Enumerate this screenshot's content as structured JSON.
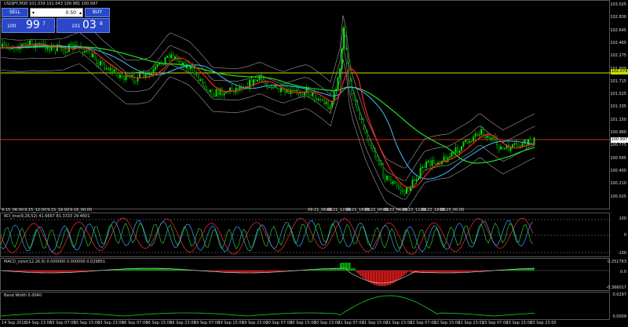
{
  "chart_title": "USDJPY,M30  101.039 101.043 100.981 100.997",
  "trade_panel": {
    "sell_label": "SELL",
    "buy_label": "BUY",
    "volume": "0.50",
    "bid_small": "100",
    "bid_big": "99",
    "bid_sup": "7",
    "ask_small": "101",
    "ask_big": "03",
    "ask_sup": "8"
  },
  "price_axis": [
    "103.025",
    "102.830",
    "102.645",
    "102.465",
    "102.275",
    "101.900",
    "101.715",
    "101.525",
    "101.335",
    "101.150",
    "100.960",
    "100.775",
    "100.585",
    "100.400",
    "100.210",
    "100.025"
  ],
  "price_tags": {
    "hline": "102.074",
    "current": "100.997"
  },
  "time_markers": [
    "9:15_06:00",
    "9:15_12:00",
    "9:15_18:00",
    "9:16_00:00",
    "09:21_06:00",
    "09:21_12:00",
    "09:21_18:00",
    "09:22_00:00",
    "09:22_06:00",
    "09:22_12:00",
    "09:22_18:00",
    "09:23_00:00"
  ],
  "rci": {
    "title": "RCI_line(9,26,52) 41.6667 81.3333 29.4601",
    "axis": [
      "100",
      "0",
      "-100"
    ]
  },
  "macd": {
    "title": "MACD_color(12,26,9) 0.000000 0.000000 0.029851",
    "axis": [
      "0.251763",
      "0.0",
      "-0.366017"
    ]
  },
  "bandwidth": {
    "title": "Band Width 0.0040",
    "axis": [
      "0.0297",
      "0.0009"
    ]
  },
  "x_axis": [
    "14 Sep 2016",
    "14 Sep 23:00",
    "15 Sep 07:00",
    "15 Sep 15:00",
    "15 Sep 23:00",
    "16 Sep 07:00",
    "16 Sep 15:00",
    "16 Sep 23:00",
    "19 Sep 07:00",
    "19 Sep 15:00",
    "19 Sep 23:00",
    "20 Sep 07:00",
    "20 Sep 15:00",
    "20 Sep 23:00",
    "21 Sep 07:00",
    "21 Sep 15:00",
    "21 Sep 23:00",
    "22 Sep 07:00",
    "22 Sep 15:00",
    "22 Sep 23:00",
    "23 Sep 07:00",
    "23 Sep 15:00",
    "23 Sep 23:00"
  ],
  "colors": {
    "candle": "#00e000",
    "ma_fast": "#ff2020",
    "ma_mid": "#40c0ff",
    "ma_slow": "#20e020",
    "bands": "#a0a0a0",
    "hline": "#c8e000",
    "current_line": "#c03010"
  }
}
